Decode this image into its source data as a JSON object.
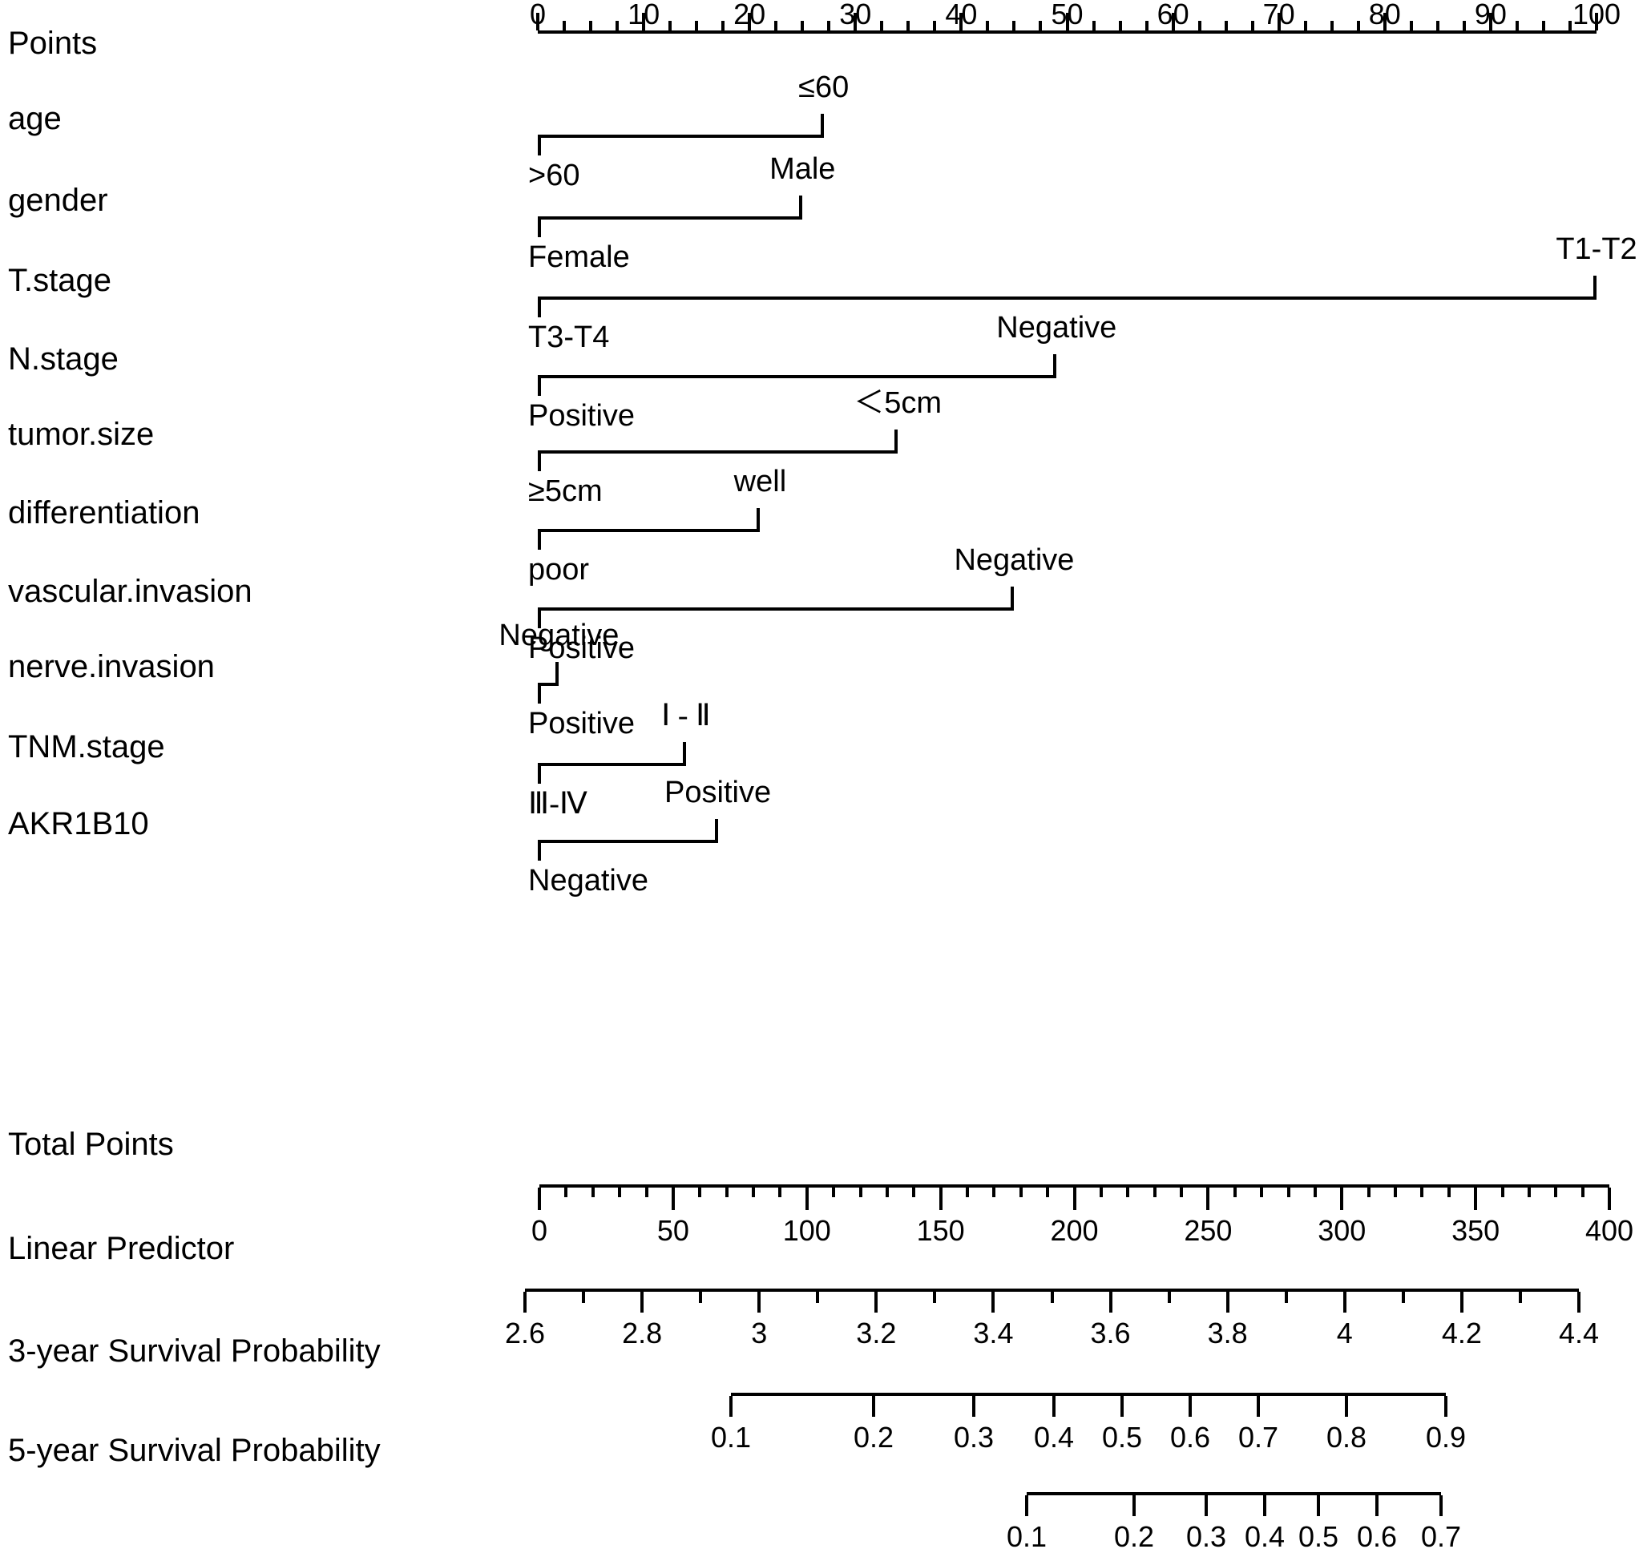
{
  "figure": {
    "type": "nomogram",
    "points_axis": {
      "label": "Points",
      "min": 0,
      "max": 100,
      "major_ticks": [
        0,
        10,
        20,
        30,
        40,
        50,
        60,
        70,
        80,
        90,
        100
      ],
      "minor_step": 2.5,
      "tick_labels": [
        "0",
        "10",
        "20",
        "30",
        "40",
        "50",
        "60",
        "70",
        "80",
        "90",
        "100"
      ],
      "labels_position": "above"
    },
    "predictors": [
      {
        "name": "age",
        "label": "age",
        "levels": [
          {
            "label": ">60",
            "points": 0,
            "label_position": "below-left",
            "serif": false
          },
          {
            "label": "≤60",
            "points": 27,
            "label_position": "above-right",
            "serif": false
          }
        ]
      },
      {
        "name": "gender",
        "label": "gender",
        "levels": [
          {
            "label": "Female",
            "points": 0,
            "label_position": "below-left",
            "serif": false
          },
          {
            "label": "Male",
            "points": 25,
            "label_position": "above-right",
            "serif": false
          }
        ]
      },
      {
        "name": "T.stage",
        "label": "T.stage",
        "levels": [
          {
            "label": "T3-T4",
            "points": 0,
            "label_position": "below-left",
            "serif": false
          },
          {
            "label": "T1-T2",
            "points": 100,
            "label_position": "above-right",
            "serif": false
          }
        ]
      },
      {
        "name": "N.stage",
        "label": "N.stage",
        "levels": [
          {
            "label": "Positive",
            "points": 0,
            "label_position": "below-left",
            "serif": false
          },
          {
            "label": "Negative",
            "points": 49,
            "label_position": "above-right",
            "serif": false
          }
        ]
      },
      {
        "name": "tumor.size",
        "label": "tumor.size",
        "levels": [
          {
            "label": "≥5cm",
            "points": 0,
            "label_position": "below-left",
            "serif": false
          },
          {
            "label": "＜5cm",
            "points": 34,
            "label_position": "above-right",
            "serif": false
          }
        ]
      },
      {
        "name": "differentiation",
        "label": "differentiation",
        "levels": [
          {
            "label": "poor",
            "points": 0,
            "label_position": "below-left",
            "serif": false
          },
          {
            "label": "well",
            "points": 21,
            "label_position": "above-right",
            "serif": false
          }
        ]
      },
      {
        "name": "vascular.invasion",
        "label": "vascular.invasion",
        "levels": [
          {
            "label": "Positive",
            "points": 0,
            "label_position": "below-left",
            "serif": false
          },
          {
            "label": "Negative",
            "points": 45,
            "label_position": "above-right",
            "serif": false
          }
        ]
      },
      {
        "name": "nerve.invasion",
        "label": "nerve.invasion",
        "levels": [
          {
            "label": "Positive",
            "points": 0,
            "label_position": "below-left",
            "serif": false
          },
          {
            "label": "Negative",
            "points": 2,
            "label_position": "above-right",
            "serif": false
          }
        ]
      },
      {
        "name": "TNM.stage",
        "label": "TNM.stage",
        "levels": [
          {
            "label": "Ⅲ-Ⅳ",
            "points": 0,
            "label_position": "below-left",
            "serif": true
          },
          {
            "label": "Ⅰ - Ⅱ",
            "points": 14,
            "label_position": "above-right",
            "serif": true
          }
        ]
      },
      {
        "name": "AKR1B10",
        "label": "AKR1B10",
        "levels": [
          {
            "label": "Negative",
            "points": 0,
            "label_position": "below-left",
            "serif": false
          },
          {
            "label": "Positive",
            "points": 17,
            "label_position": "above-right",
            "serif": false
          }
        ]
      }
    ],
    "total_points_axis": {
      "label": "Total Points",
      "min": 0,
      "max": 400,
      "major_ticks": [
        0,
        50,
        100,
        150,
        200,
        250,
        300,
        350,
        400
      ],
      "mid_step": 25,
      "minor_step": 10,
      "tick_labels": [
        "0",
        "50",
        "100",
        "150",
        "200",
        "250",
        "300",
        "350",
        "400"
      ],
      "labels_position": "below"
    },
    "linear_predictor_axis": {
      "label": "Linear Predictor",
      "min": 2.6,
      "max": 4.4,
      "major_ticks": [
        2.6,
        2.8,
        3,
        3.2,
        3.4,
        3.6,
        3.8,
        4,
        4.2,
        4.4
      ],
      "minor_step": 0.1,
      "tick_labels": [
        "2.6",
        "2.8",
        "3",
        "3.2",
        "3.4",
        "3.6",
        "3.8",
        "4",
        "4.2",
        "4.4"
      ],
      "labels_position": "below"
    },
    "survival_axes": [
      {
        "label": "3-year Survival Probability",
        "tick_labels": [
          "0.1",
          "0.2",
          "0.3",
          "0.4",
          "0.5",
          "0.6",
          "0.7",
          "0.8",
          "0.9"
        ],
        "tick_values": [
          0.1,
          0.2,
          0.3,
          0.4,
          0.5,
          0.6,
          0.7,
          0.8,
          0.9
        ],
        "tick_x": [
          912,
          1090,
          1215,
          1315,
          1400,
          1485,
          1570,
          1680,
          1804
        ],
        "x_start": 912,
        "x_end": 1804
      },
      {
        "label": "5-year Survival Probability",
        "tick_labels": [
          "0.1",
          "0.2",
          "0.3",
          "0.4",
          "0.5",
          "0.6",
          "0.7"
        ],
        "tick_values": [
          0.1,
          0.2,
          0.3,
          0.4,
          0.5,
          0.6,
          0.7
        ],
        "tick_x": [
          1281,
          1415,
          1505,
          1578,
          1645,
          1718,
          1798
        ],
        "x_start": 1281,
        "x_end": 1798
      }
    ]
  },
  "chart_data": {
    "type": "nomogram",
    "title": "",
    "xlabel": "",
    "ylabel": "",
    "points_scale": {
      "min": 0,
      "max": 100
    },
    "total_points_scale": {
      "min": 0,
      "max": 400
    },
    "linear_predictor_scale": {
      "min": 2.6,
      "max": 4.4
    },
    "series": [
      {
        "name": "age",
        "categories": [
          ">60",
          "≤60"
        ],
        "values": [
          0,
          27
        ]
      },
      {
        "name": "gender",
        "categories": [
          "Female",
          "Male"
        ],
        "values": [
          0,
          25
        ]
      },
      {
        "name": "T.stage",
        "categories": [
          "T3-T4",
          "T1-T2"
        ],
        "values": [
          0,
          100
        ]
      },
      {
        "name": "N.stage",
        "categories": [
          "Positive",
          "Negative"
        ],
        "values": [
          0,
          49
        ]
      },
      {
        "name": "tumor.size",
        "categories": [
          "≥5cm",
          "＜5cm"
        ],
        "values": [
          0,
          34
        ]
      },
      {
        "name": "differentiation",
        "categories": [
          "poor",
          "well"
        ],
        "values": [
          0,
          21
        ]
      },
      {
        "name": "vascular.invasion",
        "categories": [
          "Positive",
          "Negative"
        ],
        "values": [
          0,
          45
        ]
      },
      {
        "name": "nerve.invasion",
        "categories": [
          "Positive",
          "Negative"
        ],
        "values": [
          0,
          2
        ]
      },
      {
        "name": "TNM.stage",
        "categories": [
          "Ⅲ-Ⅳ",
          "Ⅰ - Ⅱ"
        ],
        "values": [
          0,
          14
        ]
      },
      {
        "name": "AKR1B10",
        "categories": [
          "Negative",
          "Positive"
        ],
        "values": [
          0,
          17
        ]
      }
    ],
    "survival_3yr": {
      "probabilities": [
        0.1,
        0.2,
        0.3,
        0.4,
        0.5,
        0.6,
        0.7,
        0.8,
        0.9
      ]
    },
    "survival_5yr": {
      "probabilities": [
        0.1,
        0.2,
        0.3,
        0.4,
        0.5,
        0.6,
        0.7
      ]
    },
    "grid": false,
    "legend": "none"
  }
}
